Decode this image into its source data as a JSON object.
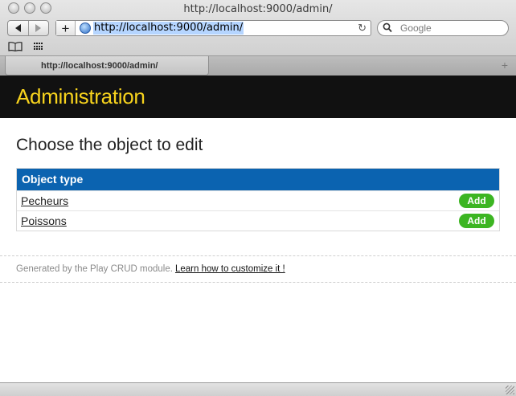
{
  "window": {
    "title": "http://localhost:9000/admin/"
  },
  "toolbar": {
    "new_tab_plus": "+",
    "url": "http://localhost:9000/admin/",
    "reload_glyph": "↻",
    "search_placeholder": "Google"
  },
  "tabs": [
    {
      "label": "http://localhost:9000/admin/",
      "active": true
    }
  ],
  "tabbar": {
    "add_glyph": "+"
  },
  "page": {
    "header_title": "Administration",
    "heading": "Choose the object to edit",
    "table": {
      "column_header": "Object type",
      "rows": [
        {
          "name": "Pecheurs",
          "action": "Add"
        },
        {
          "name": "Poissons",
          "action": "Add"
        }
      ]
    },
    "footer": {
      "text": "Generated by the Play CRUD module.",
      "link": "Learn how to customize it !"
    }
  },
  "colors": {
    "header_bg": "#111111",
    "header_title": "#f7d31d",
    "table_header_bg": "#0b63b0",
    "add_button": "#3cb522"
  },
  "icons": [
    "back-icon",
    "forward-icon",
    "globe-icon",
    "reload-icon",
    "search-icon",
    "bookmarks-icon",
    "top-sites-icon",
    "resize-grip-icon"
  ]
}
